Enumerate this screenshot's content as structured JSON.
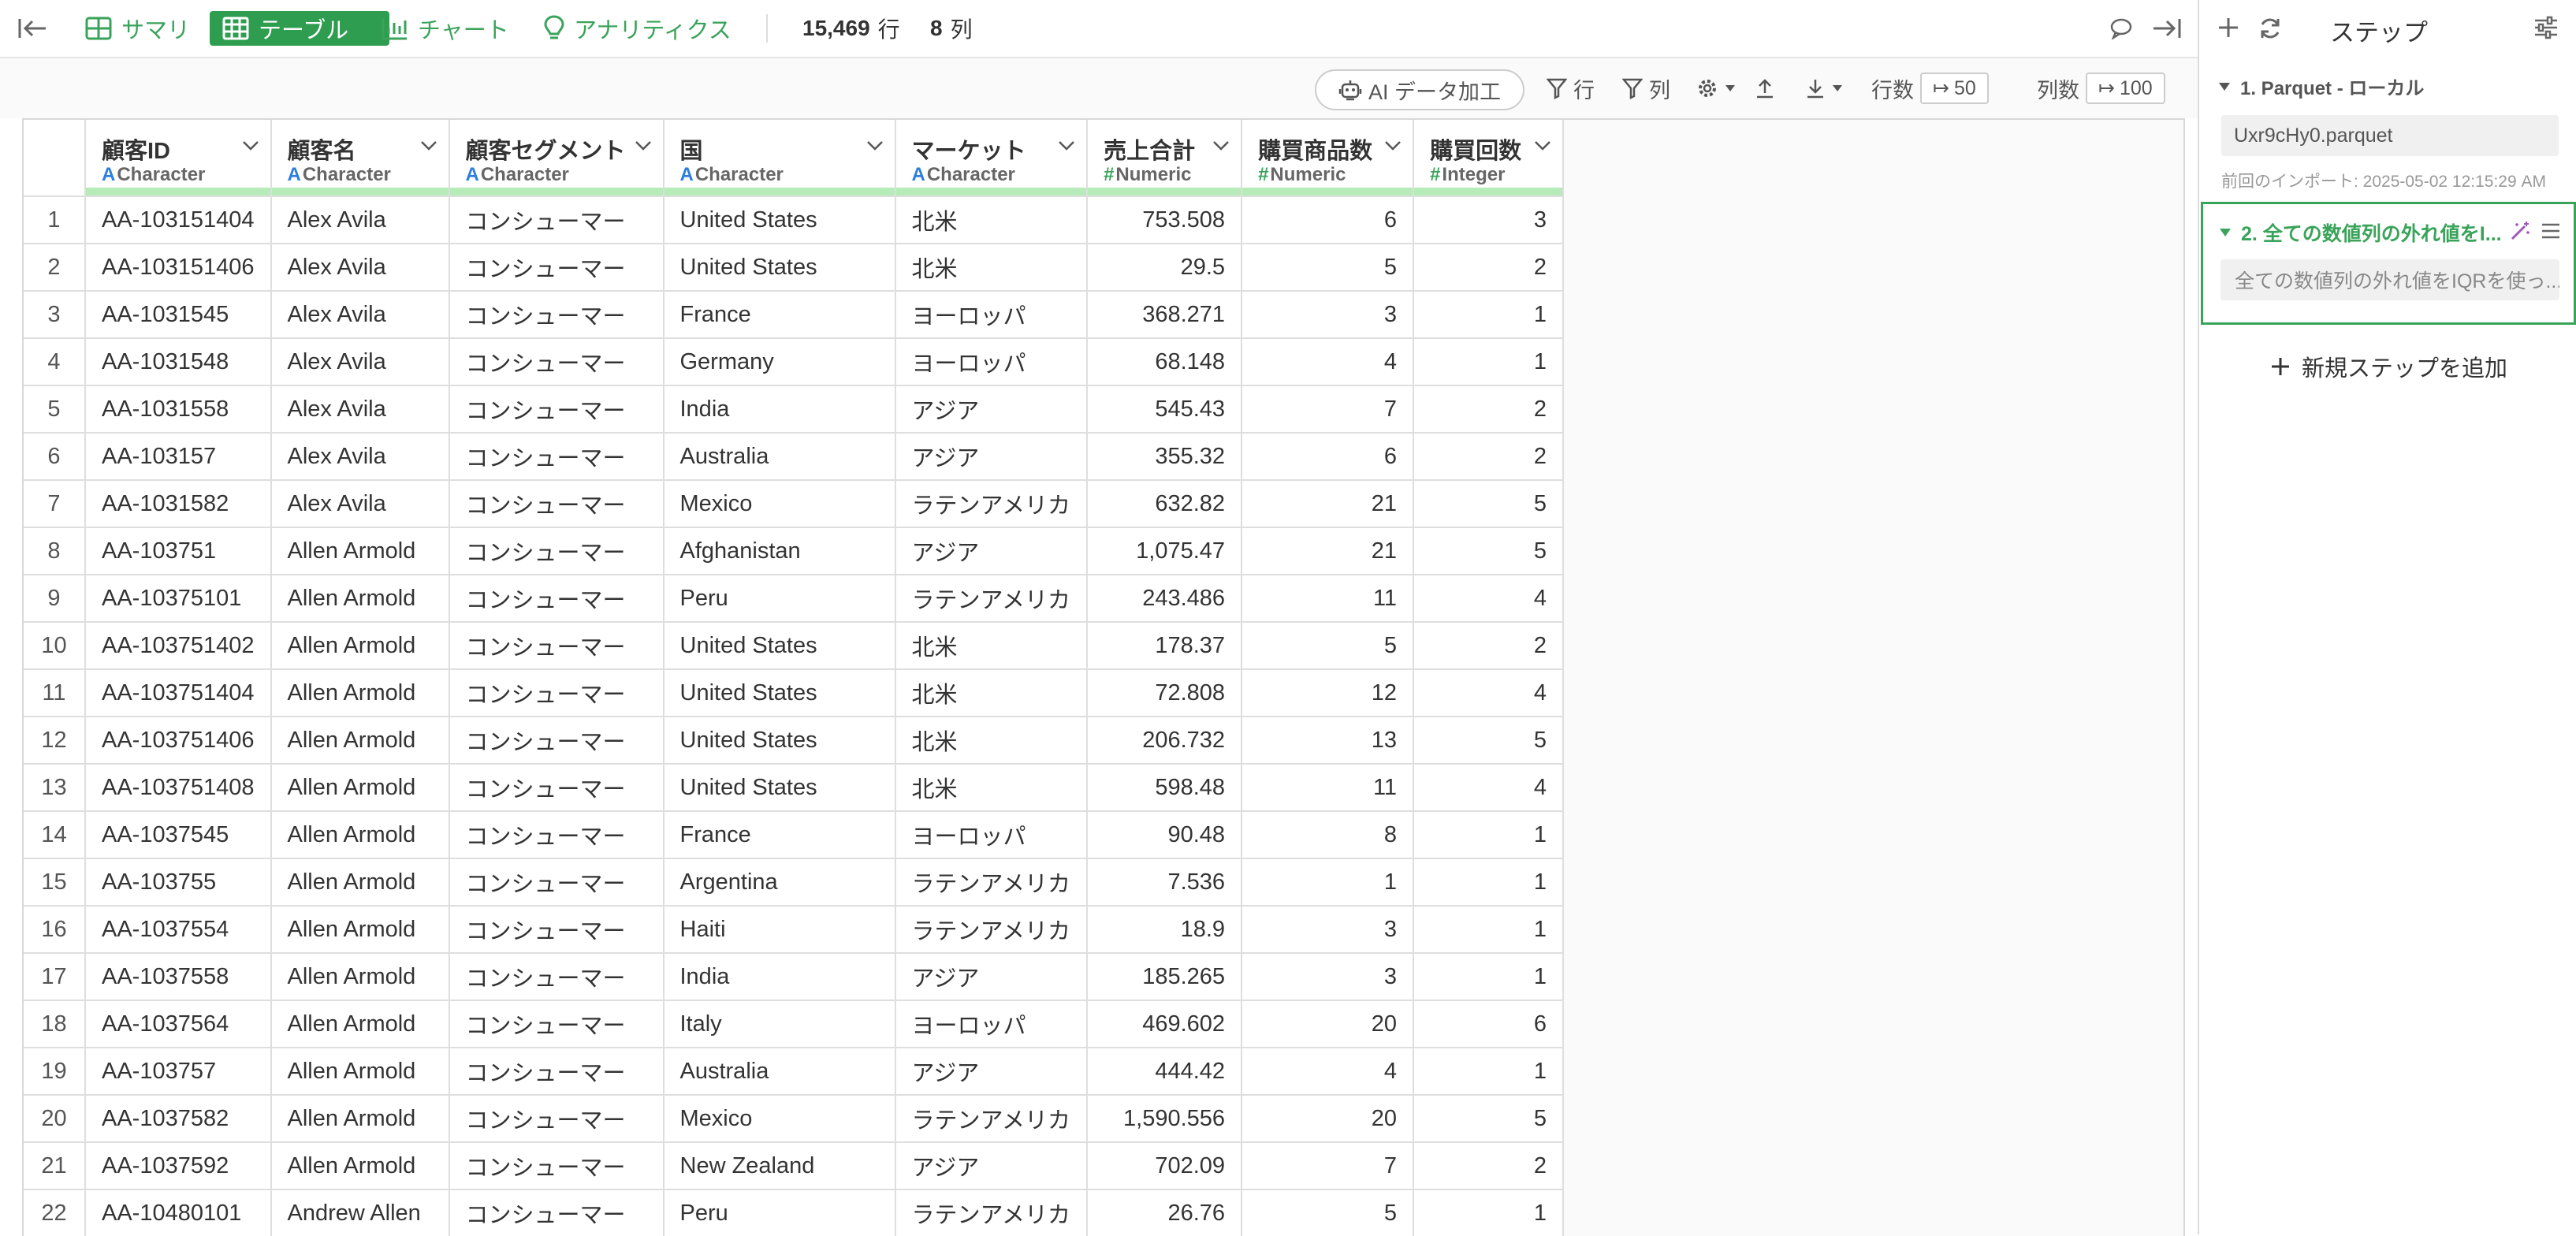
{
  "toolbar_top": {
    "nav": [
      {
        "label": "サマリ",
        "icon": "summary-icon"
      },
      {
        "label": "テーブル",
        "icon": "table-icon",
        "active": true
      },
      {
        "label": "チャート",
        "icon": "chart-icon"
      },
      {
        "label": "アナリティクス",
        "icon": "analytics-icon"
      }
    ],
    "rows_count": "15,469",
    "rows_unit": "行",
    "cols_count": "8",
    "cols_unit": "列"
  },
  "toolbar": {
    "ai_label": "AI データ加工",
    "row_filter_label": "行",
    "col_filter_label": "列",
    "row_count_label": "行数",
    "row_count_value": "50",
    "col_count_label": "列数",
    "col_count_value": "100"
  },
  "table": {
    "columns": [
      {
        "name": "顧客ID",
        "type": "Character",
        "type_symbol": "A"
      },
      {
        "name": "顧客名",
        "type": "Character",
        "type_symbol": "A"
      },
      {
        "name": "顧客セグメント",
        "type": "Character",
        "type_symbol": "A"
      },
      {
        "name": "国",
        "type": "Character",
        "type_symbol": "A"
      },
      {
        "name": "マーケット",
        "type": "Character",
        "type_symbol": "A"
      },
      {
        "name": "売上合計",
        "type": "Numeric",
        "type_symbol": "#"
      },
      {
        "name": "購買商品数",
        "type": "Numeric",
        "type_symbol": "#"
      },
      {
        "name": "購買回数",
        "type": "Integer",
        "type_symbol": "#"
      }
    ],
    "rows": [
      [
        "1",
        "AA-103151404",
        "Alex Avila",
        "コンシューマー",
        "United States",
        "北米",
        "753.508",
        "6",
        "3"
      ],
      [
        "2",
        "AA-103151406",
        "Alex Avila",
        "コンシューマー",
        "United States",
        "北米",
        "29.5",
        "5",
        "2"
      ],
      [
        "3",
        "AA-1031545",
        "Alex Avila",
        "コンシューマー",
        "France",
        "ヨーロッパ",
        "368.271",
        "3",
        "1"
      ],
      [
        "4",
        "AA-1031548",
        "Alex Avila",
        "コンシューマー",
        "Germany",
        "ヨーロッパ",
        "68.148",
        "4",
        "1"
      ],
      [
        "5",
        "AA-1031558",
        "Alex Avila",
        "コンシューマー",
        "India",
        "アジア",
        "545.43",
        "7",
        "2"
      ],
      [
        "6",
        "AA-103157",
        "Alex Avila",
        "コンシューマー",
        "Australia",
        "アジア",
        "355.32",
        "6",
        "2"
      ],
      [
        "7",
        "AA-1031582",
        "Alex Avila",
        "コンシューマー",
        "Mexico",
        "ラテンアメリカ",
        "632.82",
        "21",
        "5"
      ],
      [
        "8",
        "AA-103751",
        "Allen Armold",
        "コンシューマー",
        "Afghanistan",
        "アジア",
        "1,075.47",
        "21",
        "5"
      ],
      [
        "9",
        "AA-10375101",
        "Allen Armold",
        "コンシューマー",
        "Peru",
        "ラテンアメリカ",
        "243.486",
        "11",
        "4"
      ],
      [
        "10",
        "AA-103751402",
        "Allen Armold",
        "コンシューマー",
        "United States",
        "北米",
        "178.37",
        "5",
        "2"
      ],
      [
        "11",
        "AA-103751404",
        "Allen Armold",
        "コンシューマー",
        "United States",
        "北米",
        "72.808",
        "12",
        "4"
      ],
      [
        "12",
        "AA-103751406",
        "Allen Armold",
        "コンシューマー",
        "United States",
        "北米",
        "206.732",
        "13",
        "5"
      ],
      [
        "13",
        "AA-103751408",
        "Allen Armold",
        "コンシューマー",
        "United States",
        "北米",
        "598.48",
        "11",
        "4"
      ],
      [
        "14",
        "AA-1037545",
        "Allen Armold",
        "コンシューマー",
        "France",
        "ヨーロッパ",
        "90.48",
        "8",
        "1"
      ],
      [
        "15",
        "AA-103755",
        "Allen Armold",
        "コンシューマー",
        "Argentina",
        "ラテンアメリカ",
        "7.536",
        "1",
        "1"
      ],
      [
        "16",
        "AA-1037554",
        "Allen Armold",
        "コンシューマー",
        "Haiti",
        "ラテンアメリカ",
        "18.9",
        "3",
        "1"
      ],
      [
        "17",
        "AA-1037558",
        "Allen Armold",
        "コンシューマー",
        "India",
        "アジア",
        "185.265",
        "3",
        "1"
      ],
      [
        "18",
        "AA-1037564",
        "Allen Armold",
        "コンシューマー",
        "Italy",
        "ヨーロッパ",
        "469.602",
        "20",
        "6"
      ],
      [
        "19",
        "AA-103757",
        "Allen Armold",
        "コンシューマー",
        "Australia",
        "アジア",
        "444.42",
        "4",
        "1"
      ],
      [
        "20",
        "AA-1037582",
        "Allen Armold",
        "コンシューマー",
        "Mexico",
        "ラテンアメリカ",
        "1,590.556",
        "20",
        "5"
      ],
      [
        "21",
        "AA-1037592",
        "Allen Armold",
        "コンシューマー",
        "New Zealand",
        "アジア",
        "702.09",
        "7",
        "2"
      ],
      [
        "22",
        "AA-10480101",
        "Andrew Allen",
        "コンシューマー",
        "Peru",
        "ラテンアメリカ",
        "26.76",
        "5",
        "1"
      ]
    ]
  },
  "panel": {
    "title": "ステップ",
    "step1_title": "1. Parquet - ローカル",
    "step1_file": "Uxr9cHy0.parquet",
    "step1_timestamp": "前回のインポート: 2025-05-02 12:15:29 AM",
    "step2_title": "2. 全ての数値列の外れ値をI...",
    "step2_desc": "全ての数値列の外れ値をIQRを使っ...",
    "add_step_label": "新規ステップを追加"
  },
  "colors": {
    "accent": "#2e9d4f",
    "accent_text": "#3aa35a",
    "quality_bar": "#b7ebb9",
    "type_char": "#2b7de0",
    "type_num": "#3aa35a",
    "magic": "#9b59b6"
  }
}
